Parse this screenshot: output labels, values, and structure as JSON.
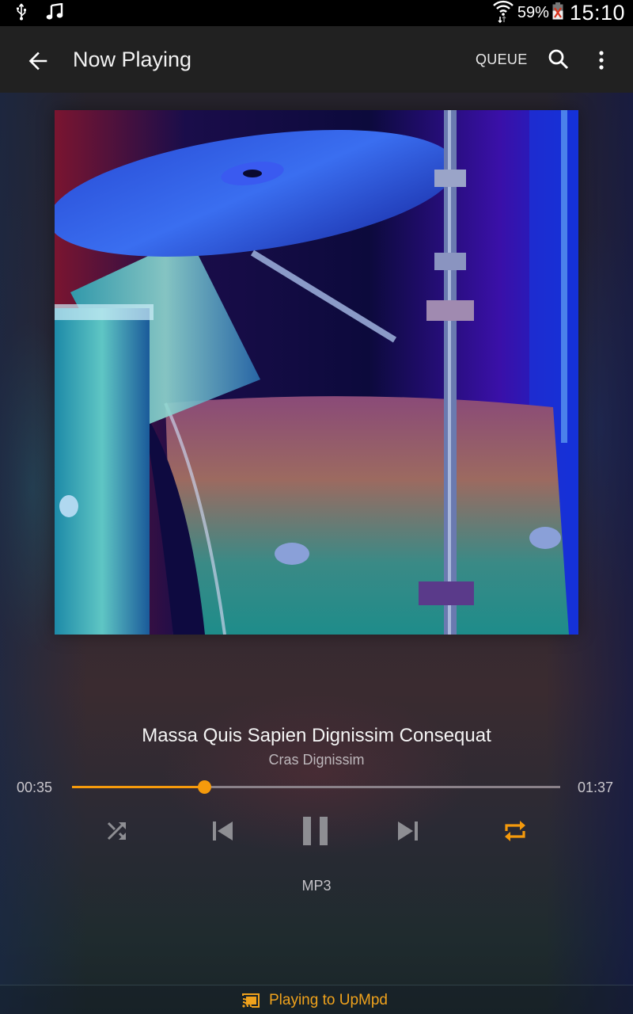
{
  "status_bar": {
    "left_icons": [
      "usb-icon",
      "music-note-icon"
    ],
    "right_icons": [
      "wifi-icon",
      "battery-icon"
    ],
    "battery_percent": "59%",
    "time": "15:10"
  },
  "app_bar": {
    "back_icon": "arrow-back-icon",
    "title": "Now Playing",
    "queue_label": "QUEUE",
    "search_icon": "search-icon",
    "more_icon": "more-vert-icon"
  },
  "now_playing": {
    "album_art": "drum-kit-photo",
    "title": "Massa Quis Sapien Dignissim Consequat",
    "artist": "Cras Dignissim",
    "elapsed": "00:35",
    "duration": "01:37",
    "progress_fraction": 0.27,
    "format": "MP3"
  },
  "controls": {
    "shuffle": {
      "icon": "shuffle-icon",
      "active": false
    },
    "previous": {
      "icon": "skip-previous-icon"
    },
    "play_pause": {
      "icon": "pause-icon",
      "state": "playing"
    },
    "next": {
      "icon": "skip-next-icon"
    },
    "repeat": {
      "icon": "repeat-icon",
      "active": true
    }
  },
  "cast": {
    "icon": "cast-connected-icon",
    "label": "Playing to UpMpd"
  },
  "colors": {
    "accent": "#f59a0c",
    "cast_text": "#f0a21c",
    "app_bar": "#212121",
    "status_bar": "#000000",
    "inactive_icon": "#8e8e93",
    "seek_track": "#8a8189"
  }
}
